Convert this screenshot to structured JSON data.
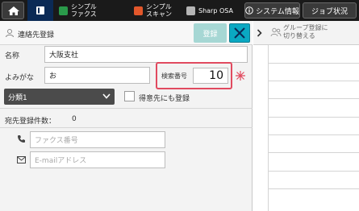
{
  "topbar": {
    "tabs": [
      {
        "label": "シンプル\nファクス",
        "color": "#2a9a4a"
      },
      {
        "label": "シンプル\nスキャン",
        "color": "#e2572b"
      },
      {
        "label": "Sharp OSA",
        "color": "#b5b5b5"
      }
    ],
    "system_info_label": "システム情報",
    "job_status_label": "ジョブ状況"
  },
  "form": {
    "title": "連絡先登録",
    "register_label": "登録",
    "name_label": "名称",
    "name_value": "大阪支社",
    "yomi_label": "よみがな",
    "yomi_value": "お",
    "search_no_label": "検索番号",
    "search_no_value": "10",
    "required_mark": "※",
    "category_value": "分類1",
    "favorite_label": "得意先にも登録",
    "count_label": "宛先登録件数：",
    "count_value": "0",
    "fax_placeholder": "ファクス番号",
    "email_placeholder": "E-mailアドレス"
  },
  "side": {
    "group_label": "グループ登録に\n切り替える"
  },
  "colors": {
    "accent": "#0aa8c2",
    "required": "#e14a5f",
    "topbar": "#1a1a1a",
    "active_tab": "#0b2a55"
  }
}
